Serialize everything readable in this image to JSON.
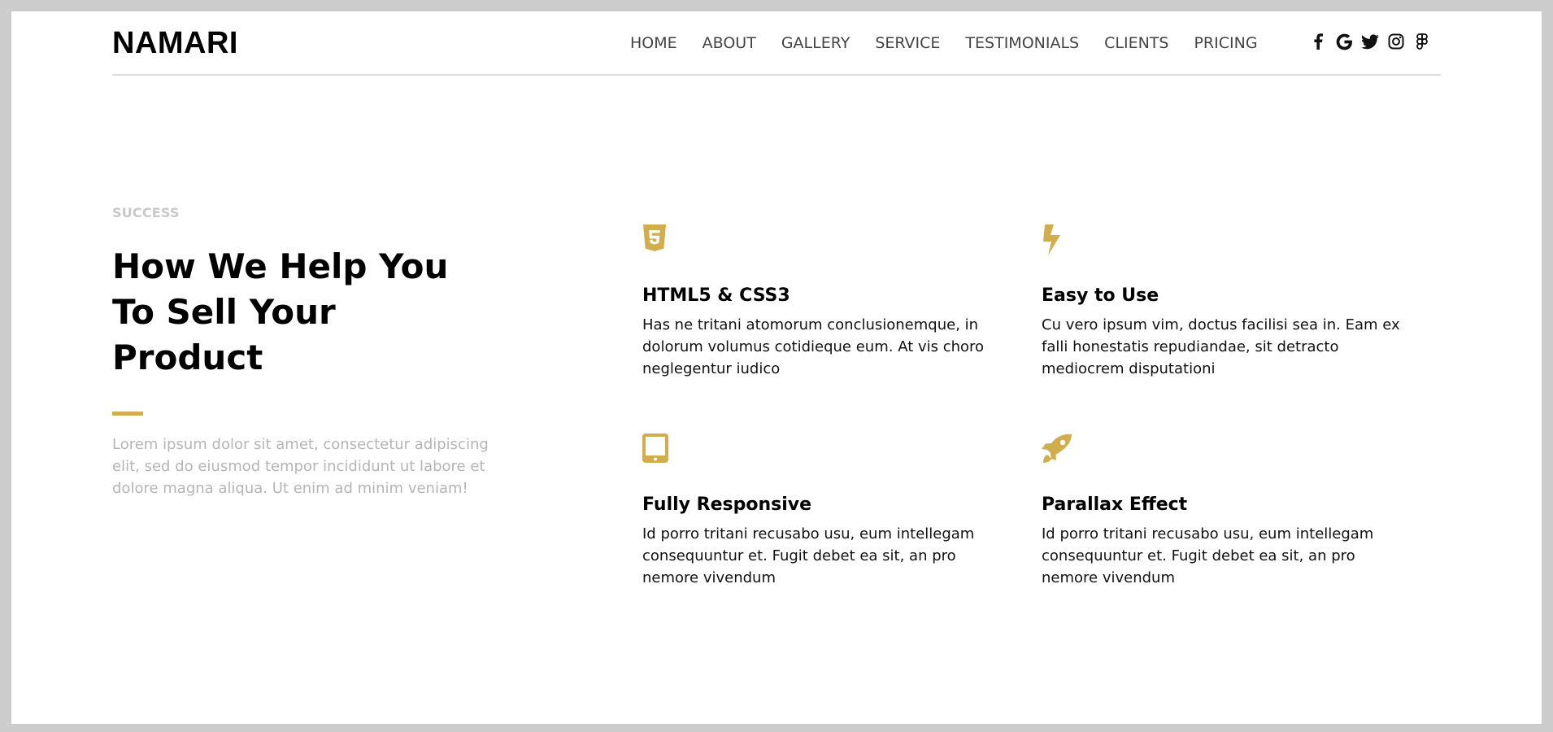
{
  "brand": {
    "logo": "NAMARI"
  },
  "nav": {
    "items": [
      {
        "label": "HOME"
      },
      {
        "label": "ABOUT"
      },
      {
        "label": "GALLERY"
      },
      {
        "label": "SERVICE"
      },
      {
        "label": "TESTIMONIALS"
      },
      {
        "label": "CLIENTS"
      },
      {
        "label": "PRICING"
      }
    ]
  },
  "social": {
    "icons": [
      "facebook-icon",
      "google-icon",
      "twitter-icon",
      "instagram-icon",
      "figma-icon"
    ]
  },
  "colors": {
    "accent": "#d1ad4e",
    "heading": "#000000",
    "muted": "#b5b5b5",
    "eyebrow": "#c8c8c8"
  },
  "intro": {
    "eyebrow": "SUCCESS",
    "headline": "How We Help You To Sell Your Product",
    "lead": "Lorem ipsum dolor sit amet, consectetur adipiscing elit, sed do eiusmod tempor incididunt ut labore et dolore magna aliqua. Ut enim ad minim veniam!"
  },
  "features": [
    {
      "icon": "html5-icon",
      "title": "HTML5 & CSS3",
      "text": "Has ne tritani atomorum conclusionemque, in dolorum volumus cotidieque eum. At vis choro neglegentur iudico"
    },
    {
      "icon": "bolt-icon",
      "title": "Easy to Use",
      "text": "Cu vero ipsum vim, doctus facilisi sea in. Eam ex falli honestatis repudiandae, sit detracto mediocrem disputationi"
    },
    {
      "icon": "tablet-icon",
      "title": "Fully Responsive",
      "text": "Id porro tritani recusabo usu, eum intellegam consequuntur et. Fugit debet ea sit, an pro nemore vivendum"
    },
    {
      "icon": "rocket-icon",
      "title": "Parallax Effect",
      "text": "Id porro tritani recusabo usu, eum intellegam consequuntur et. Fugit debet ea sit, an pro nemore vivendum"
    }
  ]
}
